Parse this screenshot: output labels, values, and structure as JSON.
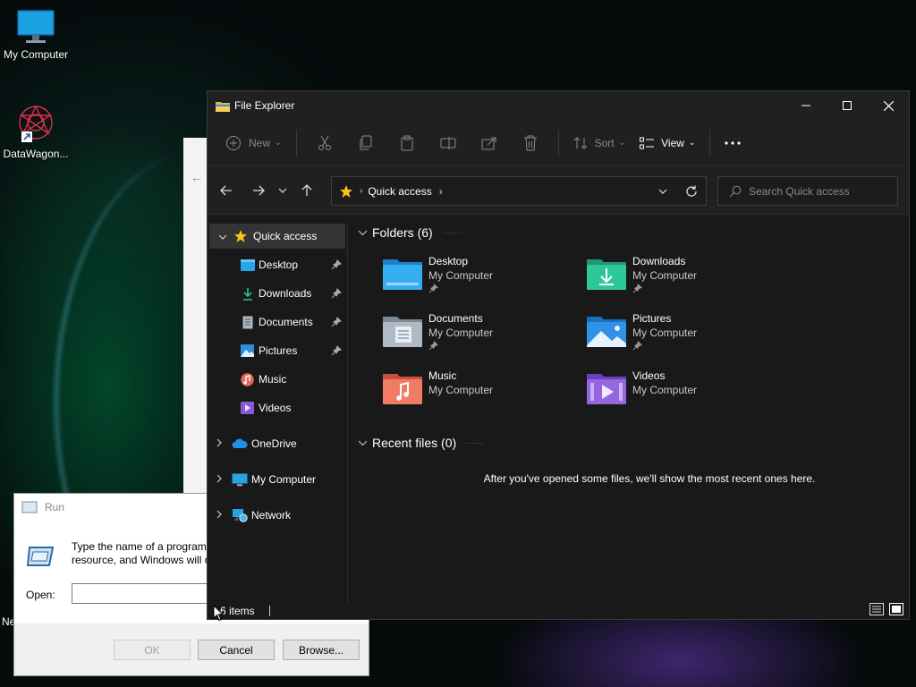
{
  "desktop": {
    "icons": [
      {
        "label": "My Computer"
      },
      {
        "label": "DataWagon..."
      }
    ],
    "partial_label": "Ne"
  },
  "run_dialog": {
    "title": "Run",
    "description_line1": "Type the name of a program,",
    "description_line2": "resource, and Windows will o",
    "open_label": "Open:",
    "open_value": "",
    "ok_label": "OK",
    "cancel_label": "Cancel",
    "browse_label": "Browse..."
  },
  "explorer": {
    "title": "File Explorer",
    "toolbar": {
      "new_label": "New",
      "sort_label": "Sort",
      "view_label": "View"
    },
    "address": {
      "crumb": "Quick access"
    },
    "search": {
      "placeholder": "Search Quick access"
    },
    "sidebar": {
      "items": [
        {
          "label": "Quick access"
        },
        {
          "label": "Desktop"
        },
        {
          "label": "Downloads"
        },
        {
          "label": "Documents"
        },
        {
          "label": "Pictures"
        },
        {
          "label": "Music"
        },
        {
          "label": "Videos"
        },
        {
          "label": "OneDrive"
        },
        {
          "label": "My Computer"
        },
        {
          "label": "Network"
        }
      ]
    },
    "folders_heading": "Folders (6)",
    "folders": [
      {
        "name": "Desktop",
        "location": "My Computer"
      },
      {
        "name": "Downloads",
        "location": "My Computer"
      },
      {
        "name": "Documents",
        "location": "My Computer"
      },
      {
        "name": "Pictures",
        "location": "My Computer"
      },
      {
        "name": "Music",
        "location": "My Computer"
      },
      {
        "name": "Videos",
        "location": "My Computer"
      }
    ],
    "recent_heading": "Recent files (0)",
    "recent_message": "After you've opened some files, we'll show the most recent ones here.",
    "status": {
      "items_count": "6 items"
    }
  },
  "colors": {
    "explorer_bg": "#191919",
    "chrome_bg": "#202020",
    "accent_yellow": "#f5c518"
  }
}
